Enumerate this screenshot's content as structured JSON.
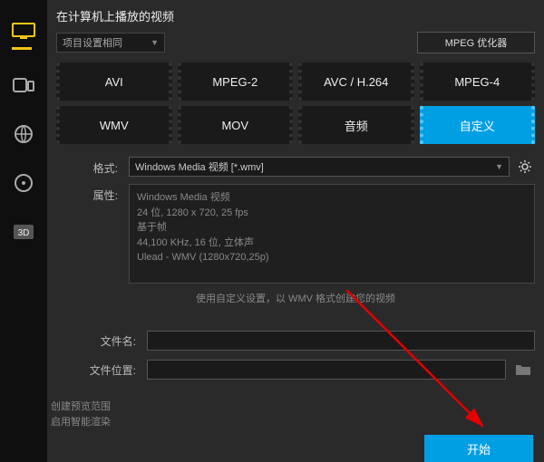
{
  "title": "在计算机上播放的视频",
  "settings_dropdown": "项目设置相同",
  "mpeg_button": "MPEG 优化器",
  "tabs_row1": [
    "AVI",
    "MPEG-2",
    "AVC / H.264",
    "MPEG-4"
  ],
  "tabs_row2": [
    "WMV",
    "MOV",
    "音频",
    "自定义"
  ],
  "labels": {
    "format": "格式:",
    "attrs": "属性:",
    "filename": "文件名:",
    "filelocation": "文件位置:"
  },
  "format_value": "Windows Media 视频 [*.wmv]",
  "attrs_text": "Windows Media 视频\n24 位, 1280 x 720, 25 fps\n基于帧\n44,100 KHz, 16 位, 立体声\nUlead - WMV (1280x720,25p)",
  "hint": "使用自定义设置，以 WMV 格式创建您的视频",
  "footer_lines": [
    "创建预览范围",
    "启用智能渲染"
  ],
  "start_button": "开始"
}
